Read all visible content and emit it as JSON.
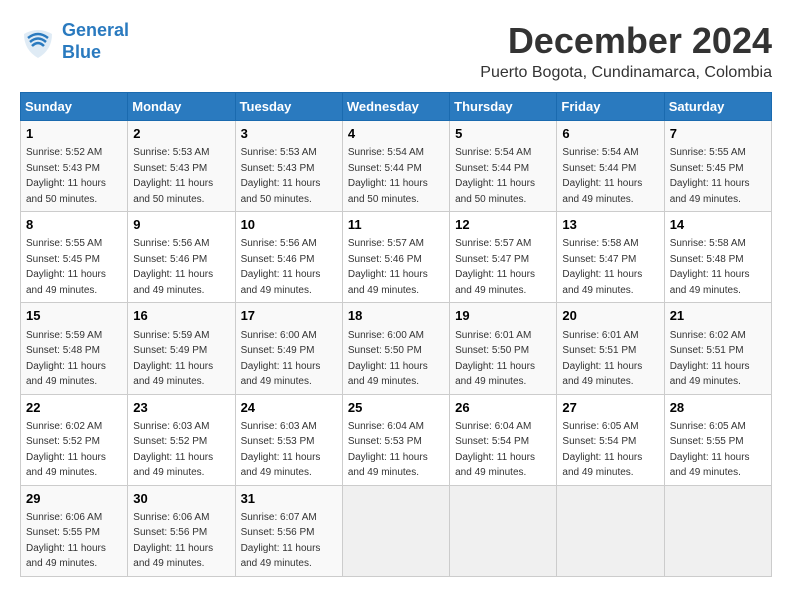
{
  "logo": {
    "line1": "General",
    "line2": "Blue"
  },
  "title": "December 2024",
  "subtitle": "Puerto Bogota, Cundinamarca, Colombia",
  "days_of_week": [
    "Sunday",
    "Monday",
    "Tuesday",
    "Wednesday",
    "Thursday",
    "Friday",
    "Saturday"
  ],
  "weeks": [
    [
      {
        "day": "1",
        "sunrise": "5:52 AM",
        "sunset": "5:43 PM",
        "daylight": "11 hours and 50 minutes."
      },
      {
        "day": "2",
        "sunrise": "5:53 AM",
        "sunset": "5:43 PM",
        "daylight": "11 hours and 50 minutes."
      },
      {
        "day": "3",
        "sunrise": "5:53 AM",
        "sunset": "5:43 PM",
        "daylight": "11 hours and 50 minutes."
      },
      {
        "day": "4",
        "sunrise": "5:54 AM",
        "sunset": "5:44 PM",
        "daylight": "11 hours and 50 minutes."
      },
      {
        "day": "5",
        "sunrise": "5:54 AM",
        "sunset": "5:44 PM",
        "daylight": "11 hours and 50 minutes."
      },
      {
        "day": "6",
        "sunrise": "5:54 AM",
        "sunset": "5:44 PM",
        "daylight": "11 hours and 49 minutes."
      },
      {
        "day": "7",
        "sunrise": "5:55 AM",
        "sunset": "5:45 PM",
        "daylight": "11 hours and 49 minutes."
      }
    ],
    [
      {
        "day": "8",
        "sunrise": "5:55 AM",
        "sunset": "5:45 PM",
        "daylight": "11 hours and 49 minutes."
      },
      {
        "day": "9",
        "sunrise": "5:56 AM",
        "sunset": "5:46 PM",
        "daylight": "11 hours and 49 minutes."
      },
      {
        "day": "10",
        "sunrise": "5:56 AM",
        "sunset": "5:46 PM",
        "daylight": "11 hours and 49 minutes."
      },
      {
        "day": "11",
        "sunrise": "5:57 AM",
        "sunset": "5:46 PM",
        "daylight": "11 hours and 49 minutes."
      },
      {
        "day": "12",
        "sunrise": "5:57 AM",
        "sunset": "5:47 PM",
        "daylight": "11 hours and 49 minutes."
      },
      {
        "day": "13",
        "sunrise": "5:58 AM",
        "sunset": "5:47 PM",
        "daylight": "11 hours and 49 minutes."
      },
      {
        "day": "14",
        "sunrise": "5:58 AM",
        "sunset": "5:48 PM",
        "daylight": "11 hours and 49 minutes."
      }
    ],
    [
      {
        "day": "15",
        "sunrise": "5:59 AM",
        "sunset": "5:48 PM",
        "daylight": "11 hours and 49 minutes."
      },
      {
        "day": "16",
        "sunrise": "5:59 AM",
        "sunset": "5:49 PM",
        "daylight": "11 hours and 49 minutes."
      },
      {
        "day": "17",
        "sunrise": "6:00 AM",
        "sunset": "5:49 PM",
        "daylight": "11 hours and 49 minutes."
      },
      {
        "day": "18",
        "sunrise": "6:00 AM",
        "sunset": "5:50 PM",
        "daylight": "11 hours and 49 minutes."
      },
      {
        "day": "19",
        "sunrise": "6:01 AM",
        "sunset": "5:50 PM",
        "daylight": "11 hours and 49 minutes."
      },
      {
        "day": "20",
        "sunrise": "6:01 AM",
        "sunset": "5:51 PM",
        "daylight": "11 hours and 49 minutes."
      },
      {
        "day": "21",
        "sunrise": "6:02 AM",
        "sunset": "5:51 PM",
        "daylight": "11 hours and 49 minutes."
      }
    ],
    [
      {
        "day": "22",
        "sunrise": "6:02 AM",
        "sunset": "5:52 PM",
        "daylight": "11 hours and 49 minutes."
      },
      {
        "day": "23",
        "sunrise": "6:03 AM",
        "sunset": "5:52 PM",
        "daylight": "11 hours and 49 minutes."
      },
      {
        "day": "24",
        "sunrise": "6:03 AM",
        "sunset": "5:53 PM",
        "daylight": "11 hours and 49 minutes."
      },
      {
        "day": "25",
        "sunrise": "6:04 AM",
        "sunset": "5:53 PM",
        "daylight": "11 hours and 49 minutes."
      },
      {
        "day": "26",
        "sunrise": "6:04 AM",
        "sunset": "5:54 PM",
        "daylight": "11 hours and 49 minutes."
      },
      {
        "day": "27",
        "sunrise": "6:05 AM",
        "sunset": "5:54 PM",
        "daylight": "11 hours and 49 minutes."
      },
      {
        "day": "28",
        "sunrise": "6:05 AM",
        "sunset": "5:55 PM",
        "daylight": "11 hours and 49 minutes."
      }
    ],
    [
      {
        "day": "29",
        "sunrise": "6:06 AM",
        "sunset": "5:55 PM",
        "daylight": "11 hours and 49 minutes."
      },
      {
        "day": "30",
        "sunrise": "6:06 AM",
        "sunset": "5:56 PM",
        "daylight": "11 hours and 49 minutes."
      },
      {
        "day": "31",
        "sunrise": "6:07 AM",
        "sunset": "5:56 PM",
        "daylight": "11 hours and 49 minutes."
      },
      null,
      null,
      null,
      null
    ]
  ]
}
